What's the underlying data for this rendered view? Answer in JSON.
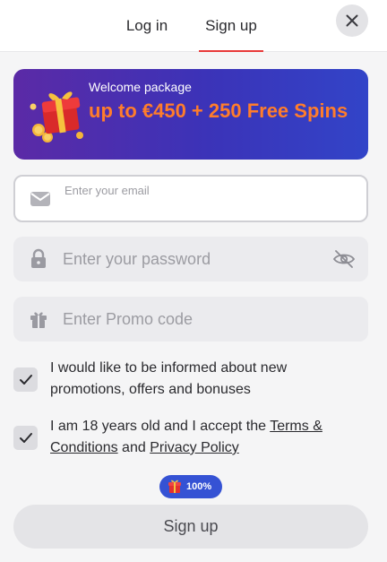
{
  "tabs": {
    "login": "Log in",
    "signup": "Sign up",
    "active": "signup"
  },
  "banner": {
    "subtitle": "Welcome package",
    "title": "up to €450 + 250 Free Spins"
  },
  "form": {
    "email_placeholder": "Enter your email",
    "password_placeholder": "Enter your password",
    "promo_placeholder": "Enter Promo code"
  },
  "checkboxes": {
    "promotions": {
      "label": "I would like to be informed about new promotions, offers and bonuses",
      "checked": true
    },
    "terms": {
      "prefix": "I am 18 years old and I accept the ",
      "terms_link": "Terms & Conditions",
      "and": " and ",
      "privacy_link": "Privacy Policy",
      "checked": true
    }
  },
  "progress_badge": "100%",
  "submit_label": "Sign up",
  "colors": {
    "accent_red": "#e83a3a",
    "banner_orange": "#ff7d2b",
    "badge_blue": "#3552d4"
  },
  "icons": {
    "close": "close-icon",
    "gift": "gift-box-icon",
    "email": "envelope-icon",
    "password": "lock-icon",
    "visibility": "eye-off-icon",
    "promo": "gift-icon",
    "check": "checkmark-icon"
  }
}
